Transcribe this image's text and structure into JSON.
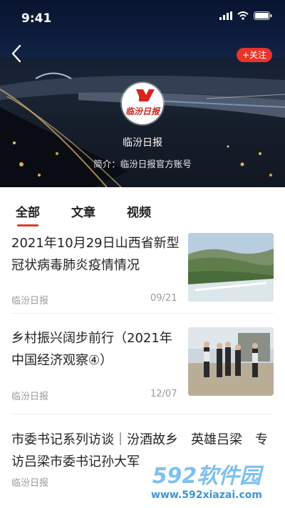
{
  "status": {
    "time": "9:41"
  },
  "account": {
    "name": "临汾日报",
    "intro": "简介：临汾日报官方账号",
    "follow_label": "+关注",
    "logo_text": "临汾日报"
  },
  "tabs": [
    {
      "label": "全部",
      "active": true
    },
    {
      "label": "文章",
      "active": false
    },
    {
      "label": "视频",
      "active": false
    }
  ],
  "articles": [
    {
      "title": "2021年10月29日山西省新型冠状病毒肺炎疫情情况",
      "source": "临汾日报",
      "date": "09/21"
    },
    {
      "title": "乡村振兴阔步前行（2021年中国经济观察④）",
      "source": "临汾日报",
      "date": "12/07"
    },
    {
      "title": "市委书记系列访谈｜汾酒故乡　英雄吕梁　专访吕梁市委书记孙大军",
      "source": "临汾日报",
      "date": ""
    }
  ],
  "watermark": {
    "brand": "592软件园",
    "url": "www.592xiazai.com"
  },
  "colors": {
    "accent": "#e03a2c",
    "follow_bg": "#e8342a"
  }
}
